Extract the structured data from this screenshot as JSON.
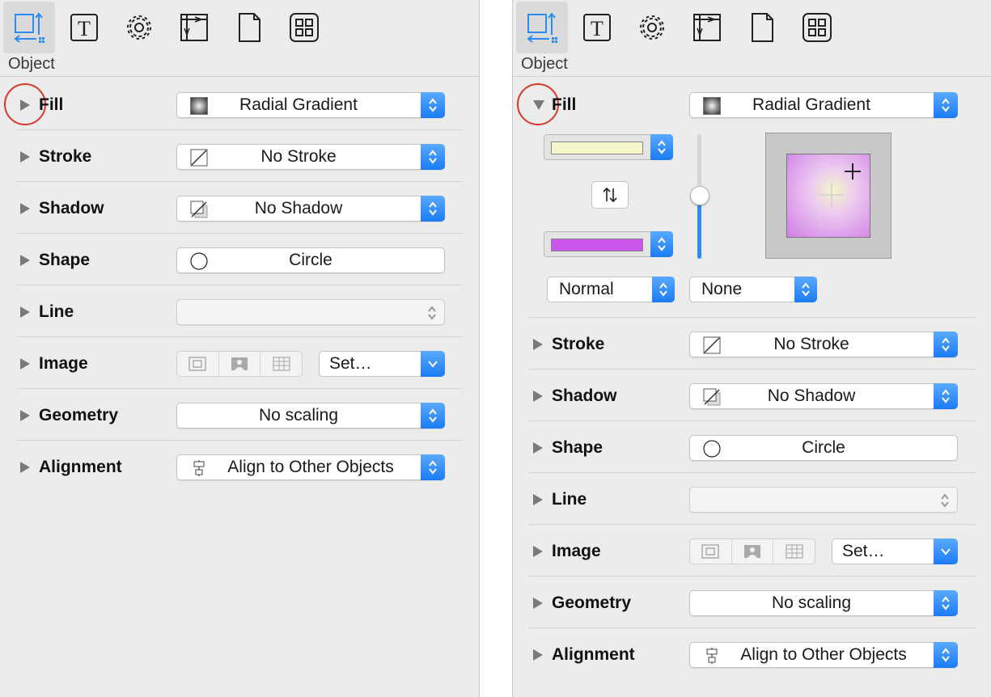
{
  "colors": {
    "accent": "#1a7cf5",
    "highlight_circle": "#d63a2a",
    "fill_top_color": "#f4f5c9",
    "fill_bottom_color": "#c955ea"
  },
  "toolbar": {
    "icons": [
      "object-inspector-icon",
      "text-icon",
      "gear-icon",
      "canvas-icon",
      "document-icon",
      "stencils-grid-icon"
    ],
    "active_index": 0
  },
  "left": {
    "section": "Object",
    "rows": {
      "fill": {
        "label": "Fill",
        "value": "Radial Gradient"
      },
      "stroke": {
        "label": "Stroke",
        "value": "No Stroke"
      },
      "shadow": {
        "label": "Shadow",
        "value": "No Shadow"
      },
      "shape": {
        "label": "Shape",
        "value": "Circle"
      },
      "line": {
        "label": "Line",
        "value": ""
      },
      "image": {
        "label": "Image",
        "value": "Set…"
      },
      "geometry": {
        "label": "Geometry",
        "value": "No scaling"
      },
      "alignment": {
        "label": "Alignment",
        "value": "Align to Other Objects"
      }
    }
  },
  "right": {
    "section": "Object",
    "rows": {
      "fill": {
        "label": "Fill",
        "value": "Radial Gradient"
      },
      "stroke": {
        "label": "Stroke",
        "value": "No Stroke"
      },
      "shadow": {
        "label": "Shadow",
        "value": "No Shadow"
      },
      "shape": {
        "label": "Shape",
        "value": "Circle"
      },
      "line": {
        "label": "Line",
        "value": ""
      },
      "image": {
        "label": "Image",
        "value": "Set…"
      },
      "geometry": {
        "label": "Geometry",
        "value": "No scaling"
      },
      "alignment": {
        "label": "Alignment",
        "value": "Align to Other Objects"
      }
    },
    "fill_detail": {
      "blend_mode": "Normal",
      "secondary": "None"
    }
  }
}
